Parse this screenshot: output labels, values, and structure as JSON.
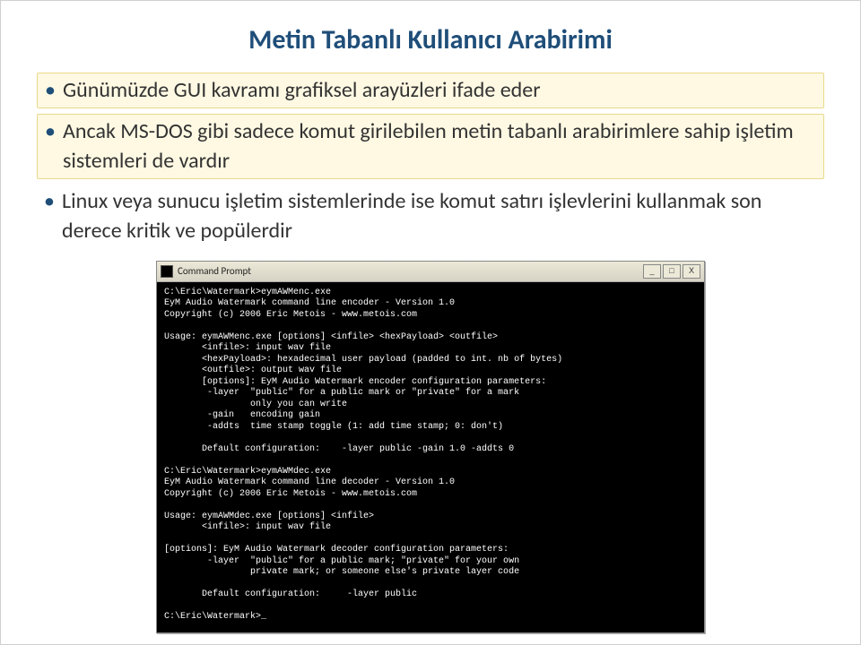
{
  "title": "Metin Tabanlı Kullanıcı Arabirimi",
  "bullets": [
    "Günümüzde GUI kavramı grafiksel arayüzleri ifade eder",
    "Ancak MS-DOS gibi sadece komut girilebilen metin tabanlı arabirimlere sahip işletim sistemleri de vardır",
    "Linux veya sunucu işletim sistemlerinde ise komut satırı işlevlerini kullanmak son derece kritik ve popülerdir"
  ],
  "terminal": {
    "title": "Command Prompt",
    "buttons": {
      "min": "_",
      "max": "□",
      "close": "X"
    },
    "content": "C:\\Eric\\Watermark>eymAWMenc.exe\nEyM Audio Watermark command line encoder - Version 1.0\nCopyright (c) 2006 Eric Metois - www.metois.com\n\nUsage: eymAWMenc.exe [options] <infile> <hexPayload> <outfile>\n       <infile>: input wav file\n       <hexPayload>: hexadecimal user payload (padded to int. nb of bytes)\n       <outfile>: output wav file\n       [options]: EyM Audio Watermark encoder configuration parameters:\n        -layer  \"public\" for a public mark or \"private\" for a mark\n                only you can write\n        -gain   encoding gain\n        -addts  time stamp toggle (1: add time stamp; 0: don't)\n\n       Default configuration:    -layer public -gain 1.0 -addts 0\n\nC:\\Eric\\Watermark>eymAWMdec.exe\nEyM Audio Watermark command line decoder - Version 1.0\nCopyright (c) 2006 Eric Metois - www.metois.com\n\nUsage: eymAWMdec.exe [options] <infile>\n       <infile>: input wav file\n\n[options]: EyM Audio Watermark decoder configuration parameters:\n        -layer  \"public\" for a public mark; \"private\" for your own\n                private mark; or someone else's private layer code\n\n       Default configuration:     -layer public\n\nC:\\Eric\\Watermark>_"
  }
}
